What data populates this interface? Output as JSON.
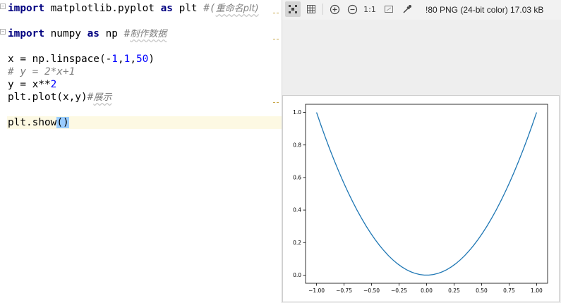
{
  "editor": {
    "lines": [
      {
        "parts": [
          {
            "t": "import",
            "c": "kw"
          },
          {
            "t": " matplotlib.pyplot "
          },
          {
            "t": "as",
            "c": "kw"
          },
          {
            "t": " plt "
          },
          {
            "t": "#(",
            "c": "cmt"
          },
          {
            "t": "重命名plt)",
            "c": "zh"
          }
        ]
      },
      {
        "parts": []
      },
      {
        "parts": [
          {
            "t": "import",
            "c": "kw"
          },
          {
            "t": " numpy "
          },
          {
            "t": "as",
            "c": "kw"
          },
          {
            "t": " np "
          },
          {
            "t": "#",
            "c": "cmt"
          },
          {
            "t": "制作数据",
            "c": "zh"
          }
        ]
      },
      {
        "parts": []
      },
      {
        "parts": [
          {
            "t": "x = np.linspace(-"
          },
          {
            "t": "1",
            "c": "num"
          },
          {
            "t": ","
          },
          {
            "t": "1",
            "c": "num"
          },
          {
            "t": ","
          },
          {
            "t": "50",
            "c": "num"
          },
          {
            "t": ")"
          }
        ]
      },
      {
        "parts": [
          {
            "t": "# y = 2*x+1",
            "c": "cmt"
          }
        ]
      },
      {
        "parts": [
          {
            "t": "y = x**"
          },
          {
            "t": "2",
            "c": "num"
          }
        ]
      },
      {
        "parts": [
          {
            "t": "plt.plot(x,y)"
          },
          {
            "t": "#",
            "c": "cmt"
          },
          {
            "t": "展示",
            "c": "zh"
          }
        ]
      },
      {
        "parts": []
      },
      {
        "parts": [
          {
            "t": "plt.show"
          },
          {
            "t": "()",
            "c": "match"
          }
        ]
      }
    ]
  },
  "viewer": {
    "toolbar": {
      "icons": [
        "fit-to-window-icon",
        "grid-icon",
        "zoom-in-icon",
        "zoom-out-icon",
        "actual-size-icon",
        "fit-image-icon",
        "color-picker-icon"
      ],
      "actual_size_label": "1:1",
      "image_info": "!80 PNG (24-bit color) 17.03 kB"
    }
  },
  "chart_data": {
    "type": "line",
    "title": "",
    "xlabel": "",
    "ylabel": "",
    "xlim": [
      -1.1,
      1.1
    ],
    "ylim": [
      -0.05,
      1.05
    ],
    "xticks": [
      -1.0,
      -0.75,
      -0.5,
      -0.25,
      0.0,
      0.25,
      0.5,
      0.75,
      1.0
    ],
    "xtick_labels": [
      "−1.00",
      "−0.75",
      "−0.50",
      "−0.25",
      "0.00",
      "0.25",
      "0.50",
      "0.75",
      "1.00"
    ],
    "yticks": [
      0.0,
      0.2,
      0.4,
      0.6,
      0.8,
      1.0
    ],
    "ytick_labels": [
      "0.0",
      "0.2",
      "0.4",
      "0.6",
      "0.8",
      "1.0"
    ],
    "series": [
      {
        "function": "y = x**2",
        "x_range": [
          -1,
          1
        ],
        "samples": 50,
        "color": "#1f77b4"
      }
    ],
    "grid": false
  }
}
